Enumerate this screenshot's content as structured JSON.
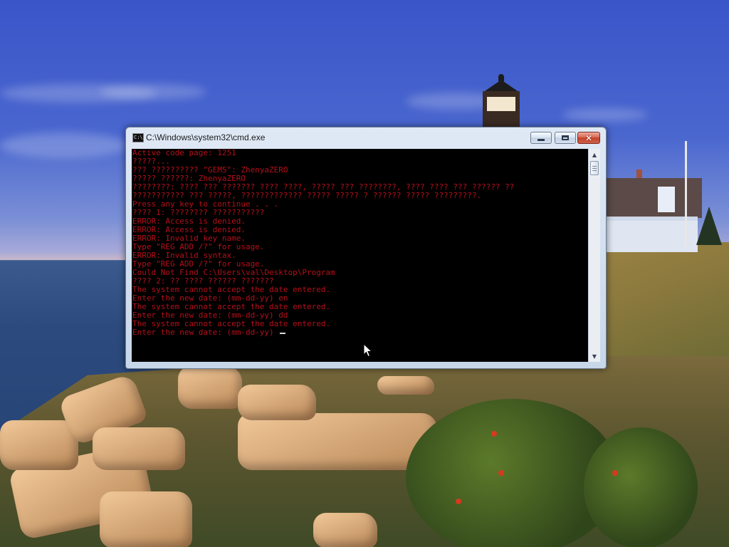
{
  "window": {
    "title": "C:\\Windows\\system32\\cmd.exe",
    "icon": "console-icon",
    "icon_glyph": "C:\\",
    "buttons": {
      "minimize_icon": "minimize-icon",
      "maximize_icon": "maximize-icon",
      "close_icon": "close-icon",
      "close_glyph": "✕"
    }
  },
  "console": {
    "text_color": "#b5101a",
    "background": "#000000",
    "lines": [
      "Active code page: 1251",
      "?????...",
      "??? ?????????? \"GEMS\": ZhenyaZERO",
      "????? ??????: ZhenyaZERO",
      "????????: ???? ??? ??????? ???? ????, ????? ??? ????????, ???? ???? ??? ?????? ??",
      "??????????? ??? ?????, ????????????? ????? ????? ? ?????? ????? ?????????.",
      "Press any key to continue . . .",
      "???? 1: ???????? ???????????",
      "ERROR: Access is denied.",
      "ERROR: Access is denied.",
      "ERROR: Invalid key name.",
      "Type \"REG ADD /?\" for usage.",
      "ERROR: Invalid syntax.",
      "Type \"REG ADD /?\" for usage.",
      "Could Not Find C:\\Users\\val\\Desktop\\Program",
      "???? 2: ?? ???? ?????? ???????",
      "The system cannot accept the date entered.",
      "Enter the new date: (mm-dd-yy) en",
      "The system cannot accept the date entered.",
      "Enter the new date: (mm-dd-yy) dd",
      "The system cannot accept the date entered.",
      "Enter the new date: (mm-dd-yy) "
    ]
  },
  "scrollbar": {
    "up_icon": "scroll-up-arrow-icon",
    "up_glyph": "▲",
    "down_icon": "scroll-down-arrow-icon",
    "down_glyph": "▼"
  }
}
